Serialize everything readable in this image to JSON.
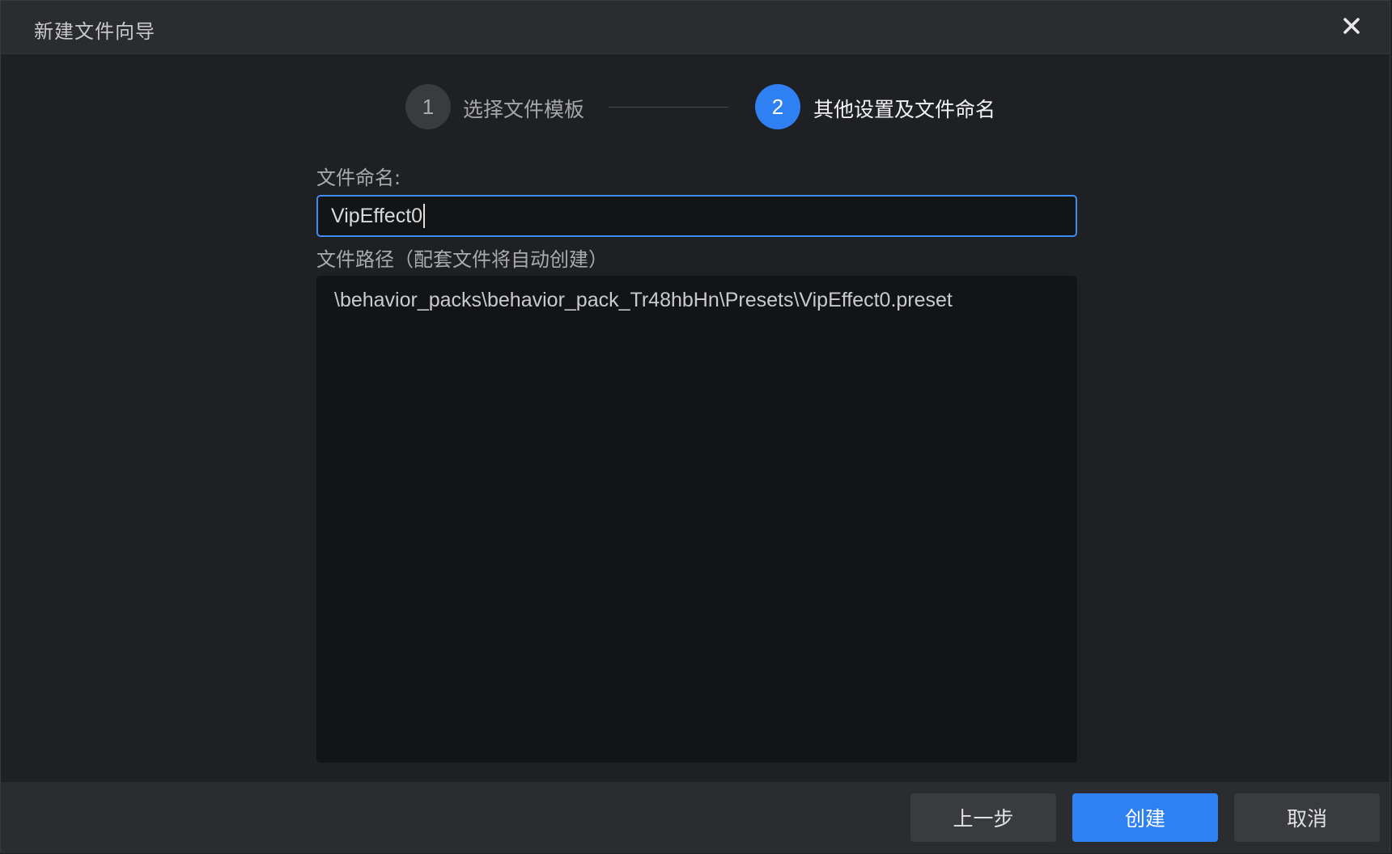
{
  "window": {
    "title": "新建文件向导",
    "close_icon": "close-icon"
  },
  "steps": [
    {
      "number": "1",
      "label": "选择文件模板",
      "state": "done"
    },
    {
      "number": "2",
      "label": "其他设置及文件命名",
      "state": "active"
    }
  ],
  "form": {
    "name_label": "文件命名:",
    "name_value": "VipEffect0",
    "path_label": "文件路径（配套文件将自动创建）",
    "path_value": "\\behavior_packs\\behavior_pack_Tr48hbHn\\Presets\\VipEffect0.preset"
  },
  "footer": {
    "prev_label": "上一步",
    "create_label": "创建",
    "cancel_label": "取消"
  },
  "colors": {
    "accent": "#2f80f2",
    "background": "#1f2023",
    "panel": "#2b2c30"
  }
}
